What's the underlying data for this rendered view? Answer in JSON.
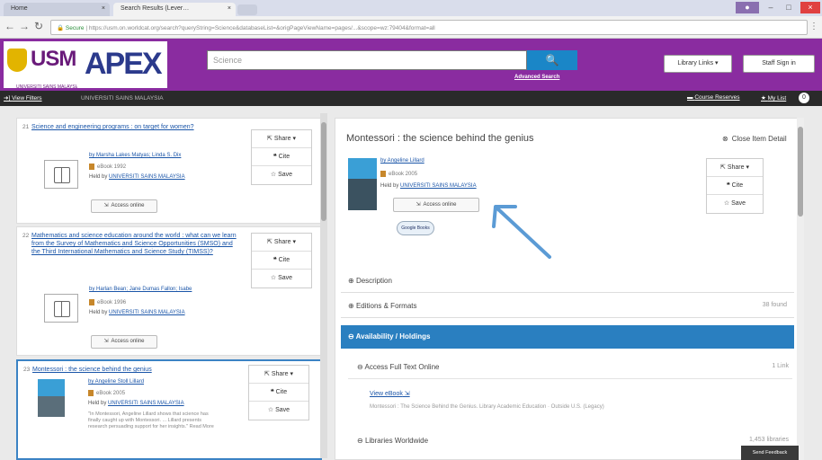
{
  "browser": {
    "tabs": [
      "Home",
      "Search Results (Lever…"
    ],
    "url_scheme": "Secure",
    "url": "https://usm.on.worldcat.org/search?queryString=Science&databaseList=&origPageViewName=pages/...&scope=wz:79404&format=all"
  },
  "header": {
    "logo_usm": "USM",
    "logo_usm_sub": "UNIVERSITI SAINS MALAYSIA",
    "logo_apex": "APEX",
    "search_placeholder": "Science",
    "advanced_search": "Advanced Search",
    "library_links": "Library Links ▾",
    "staff_sign_in": "Staff Sign in"
  },
  "subbar": {
    "view_filters": "View Filters",
    "institution": "UNIVERSITI SAINS MALAYSIA",
    "course_reserves": "Course Reserves",
    "my_list": "My List",
    "my_list_count": "0"
  },
  "results": [
    {
      "num": "21",
      "title": "Science and engineering programs : on target for women?",
      "authors": "by Marsha Lakes Matyas; Linda S. Dix",
      "format": "eBook  1992",
      "held_by": "UNIVERSITI SAINS MALAYSIA",
      "access": "Access online",
      "share": "Share ▾",
      "cite": "Cite",
      "save": "Save"
    },
    {
      "num": "22",
      "title": "Mathematics and science education around the world : what can we learn from the Survey of Mathematics and Science Opportunities (SMSO) and the Third International Mathematics and Science Study (TIMSS)?",
      "authors": "by Harlan Bean; Jane Dumas Fallon; Isabe",
      "format": "eBook  1996",
      "held_by": "UNIVERSITI SAINS MALAYSIA",
      "access": "Access online",
      "share": "Share ▾",
      "cite": "Cite",
      "save": "Save"
    },
    {
      "num": "23",
      "title": "Montessori : the science behind the genius",
      "authors": "by Angeline Stoll Lillard",
      "format": "eBook  2005",
      "held_by": "UNIVERSITI SAINS MALAYSIA",
      "snippet": "\"In Montessori, Angeline Lillard shows that science has finally caught up with Montessori. ... Lillard presents research persuading support for her insights.\" Read More",
      "share": "Share ▾",
      "cite": "Cite",
      "save": "Save"
    }
  ],
  "detail": {
    "title": "Montessori : the science behind the genius",
    "close": "Close Item Detail",
    "authors": "by Angeline Lillard",
    "format": "eBook  2005",
    "held_by_label": "Held by",
    "held_by": "UNIVERSITI SAINS MALAYSIA",
    "access": "Access online",
    "google_books": "Google Books",
    "share": "Share ▾",
    "cite": "Cite",
    "save": "Save",
    "sections": {
      "description": "Description",
      "editions": "Editions & Formats",
      "editions_count": "38 found",
      "availability": "Availability / Holdings",
      "access_full_text": "Access Full Text Online",
      "access_full_text_count": "1 Link",
      "view_ebook": "View eBook",
      "ebook_desc": "Montessori : The Science Behind the Genius. Library Academic  Education · Outside U.S. (Legacy)",
      "libraries_worldwide": "Libraries Worldwide",
      "libraries_count": "1,453 libraries"
    },
    "feedback": "Send Feedback"
  },
  "colors": {
    "header_purple": "#8a2ca0",
    "accent_blue": "#2a7fc0",
    "link_blue": "#1a55a8",
    "arrow_blue": "#5b9bd5"
  }
}
